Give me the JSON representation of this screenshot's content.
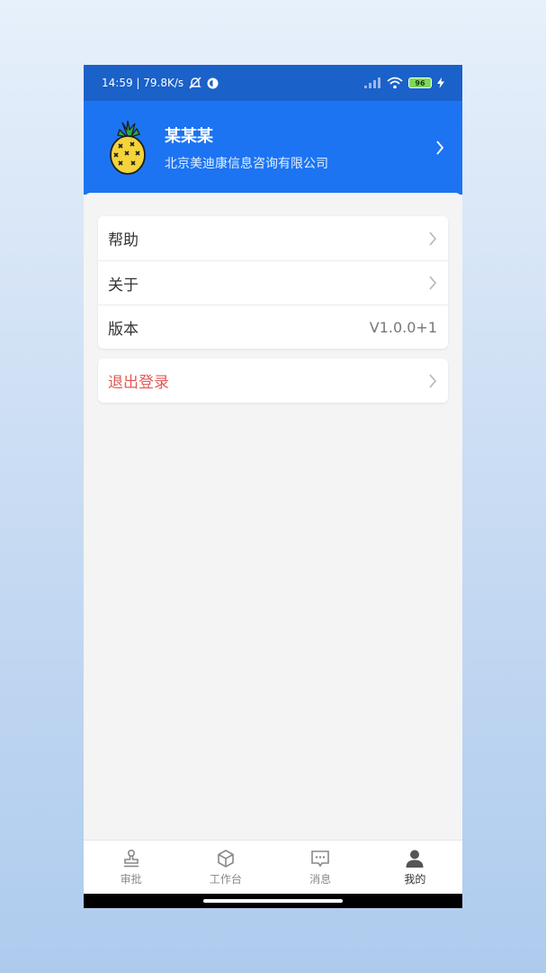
{
  "status_bar": {
    "time_speed": "14:59 | 79.8K/s",
    "battery": "96"
  },
  "profile": {
    "name": "某某某",
    "company": "北京美迪康信息咨询有限公司"
  },
  "menu": {
    "help_label": "帮助",
    "about_label": "关于",
    "version_label": "版本",
    "version_value": "V1.0.0+1"
  },
  "logout": {
    "label": "退出登录"
  },
  "tabs": [
    {
      "label": "审批",
      "icon": "stamp-icon"
    },
    {
      "label": "工作台",
      "icon": "cube-icon"
    },
    {
      "label": "消息",
      "icon": "message-icon"
    },
    {
      "label": "我的",
      "icon": "person-icon"
    }
  ],
  "colors": {
    "header_blue": "#1c74f2",
    "status_blue": "#1a61c9",
    "logout_red": "#e25a55"
  }
}
